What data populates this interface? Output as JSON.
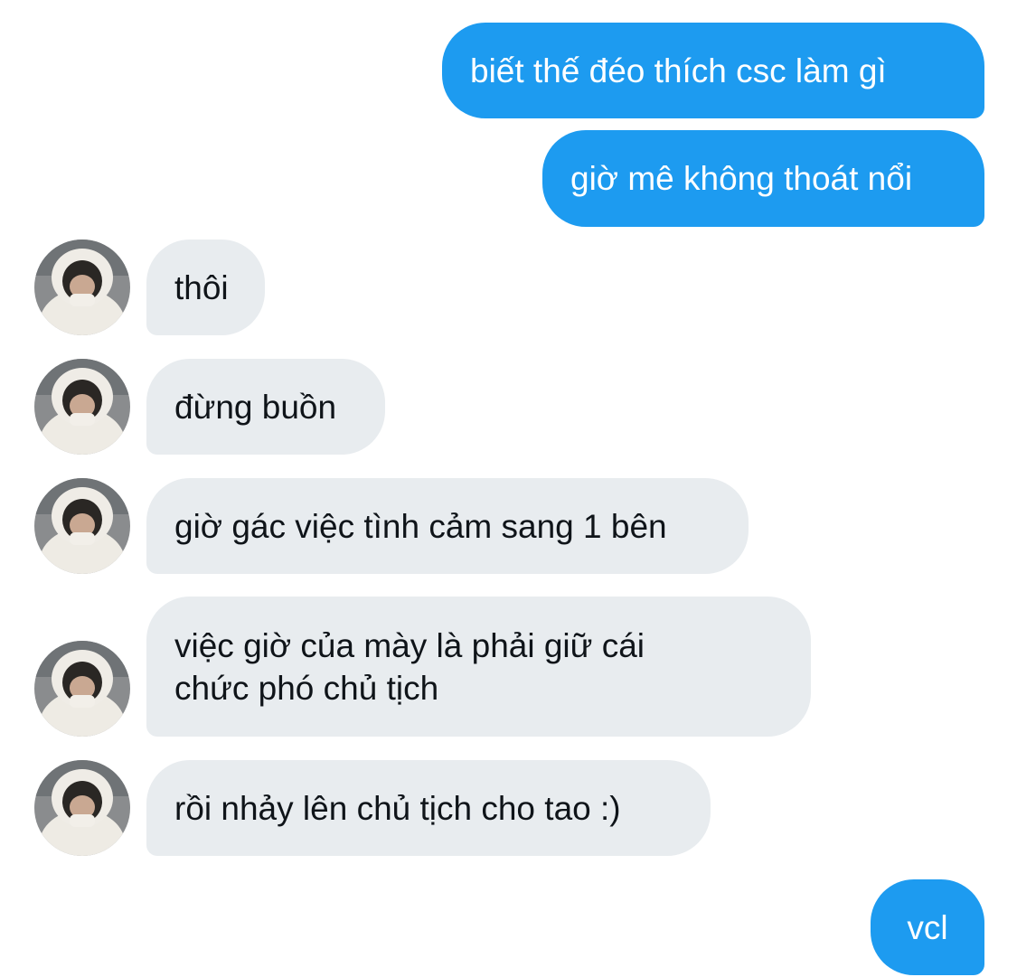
{
  "conversation": {
    "messages": [
      {
        "side": "sent",
        "text": "biết thế đéo thích csc làm gì"
      },
      {
        "side": "sent",
        "text": "giờ mê không thoát nổi"
      },
      {
        "side": "received",
        "text": "thôi"
      },
      {
        "side": "received",
        "text": "đừng buồn"
      },
      {
        "side": "received",
        "text": "giờ gác việc tình cảm sang 1 bên"
      },
      {
        "side": "received",
        "text": "việc giờ của mày là phải giữ cái chức phó chủ tịch"
      },
      {
        "side": "received",
        "text": "rồi nhảy lên chủ tịch cho tao :)"
      },
      {
        "side": "sent",
        "text": "vcl"
      }
    ]
  },
  "colors": {
    "sent_bubble": "#1d9bf0",
    "received_bubble": "#e8ecef",
    "background": "#ffffff"
  },
  "icons": {
    "contact_avatar": "avatar-photo-person-in-white-hooded-jacket"
  }
}
